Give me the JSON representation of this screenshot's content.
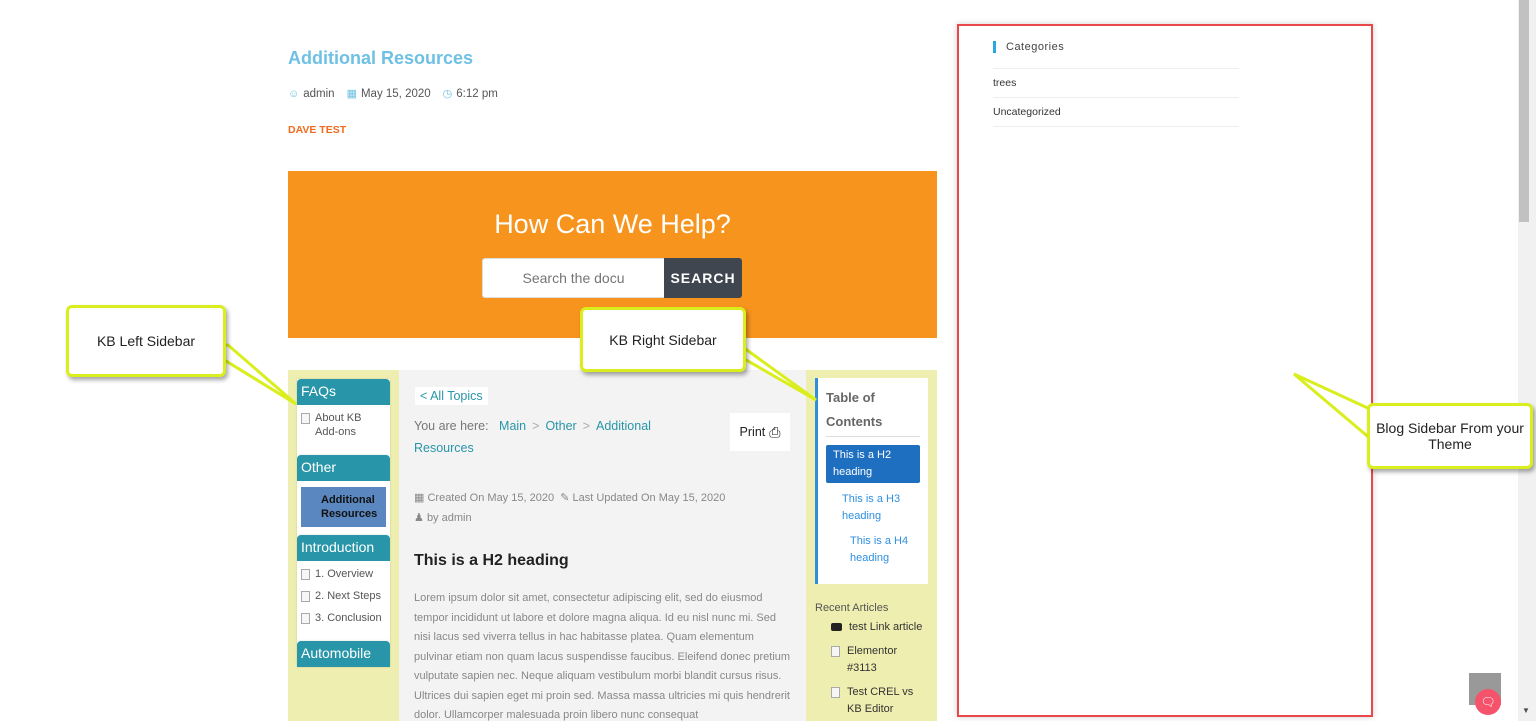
{
  "post": {
    "title": "Additional Resources",
    "author": "admin",
    "date": "May 15, 2020",
    "time": "6:12 pm",
    "category": "DAVE TEST"
  },
  "banner": {
    "title": "How Can We Help?",
    "search_placeholder": "Search the docu",
    "search_button": "SEARCH"
  },
  "kb_left": {
    "categories": [
      {
        "name": "FAQs",
        "articles": [
          {
            "title": "About KB Add-ons",
            "active": false
          }
        ]
      },
      {
        "name": "Other",
        "articles": [
          {
            "title": "Additional Resources",
            "active": true
          }
        ]
      },
      {
        "name": "Introduction",
        "articles": [
          {
            "title": "1. Overview",
            "active": false
          },
          {
            "title": "2. Next Steps",
            "active": false
          },
          {
            "title": "3. Conclusion",
            "active": false
          }
        ]
      },
      {
        "name": "Automobile",
        "articles": []
      }
    ]
  },
  "kb_main": {
    "all_topics": "< All Topics",
    "breadcrumb_label": "You are here:",
    "breadcrumb": [
      "Main",
      "Other",
      "Additional Resources"
    ],
    "print_label": "Print",
    "created_label": "Created On",
    "created_date": "May 15, 2020",
    "updated_label": "Last Updated On",
    "updated_date": "May 15, 2020",
    "by_label": "by admin",
    "heading": "This is a H2 heading",
    "body": "Lorem ipsum dolor sit amet, consectetur adipiscing elit, sed do eiusmod tempor incididunt ut labore et dolore magna aliqua. Id eu nisl nunc mi. Sed nisi lacus sed viverra tellus in hac habitasse platea. Quam elementum pulvinar etiam non quam lacus suspendisse faucibus. Eleifend donec pretium vulputate sapien nec. Neque aliquam vestibulum morbi blandit cursus risus. Ultrices dui sapien eget mi proin sed. Massa massa ultricies mi quis hendrerit dolor. Ullamcorper malesuada proin libero nunc consequat"
  },
  "kb_right": {
    "toc_title": "Table of Contents",
    "toc": [
      "This is a H2 heading",
      "This is a H3 heading",
      "This is a H4 heading"
    ],
    "recent_title": "Recent Articles",
    "recent": [
      "test Link article",
      "Elementor #3113",
      "Test CREL vs KB Editor"
    ]
  },
  "theme_sidebar": {
    "title": "Categories",
    "items": [
      "trees",
      "Uncategorized"
    ]
  },
  "callouts": {
    "left": "KB Left Sidebar",
    "right": "KB Right Sidebar",
    "blog": "Blog Sidebar From your Theme"
  },
  "colors": {
    "accent": "#6ec1e4",
    "banner": "#f7941d",
    "kb_teal": "#2896a8",
    "callout_border": "#d9ee1c",
    "sidebar_border": "#e8484a"
  }
}
